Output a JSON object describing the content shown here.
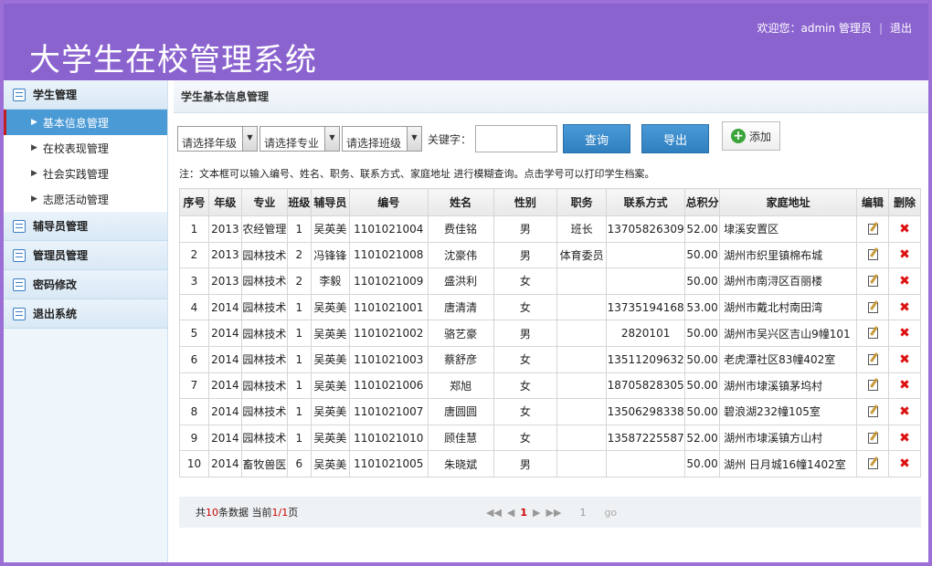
{
  "app": {
    "title": "大学生在校管理系统",
    "welcome": "欢迎您：admin 管理员",
    "logout": "退出"
  },
  "sidebar": {
    "groups": [
      {
        "label": "学生管理"
      },
      {
        "label": "辅导员管理"
      },
      {
        "label": "管理员管理"
      },
      {
        "label": "密码修改"
      },
      {
        "label": "退出系统"
      }
    ],
    "sub_items": [
      {
        "label": "基本信息管理"
      },
      {
        "label": "在校表现管理"
      },
      {
        "label": "社会实践管理"
      },
      {
        "label": "志愿活动管理"
      }
    ]
  },
  "main": {
    "heading": "学生基本信息管理",
    "filters": {
      "year": "请选择年级",
      "major": "请选择专业",
      "class": "请选择班级",
      "keyword_label": "关键字：",
      "keyword_value": ""
    },
    "buttons": {
      "query": "查询",
      "export": "导出",
      "add": "添加"
    },
    "note": "注：文本框可以输入编号、姓名、职务、联系方式、家庭地址 进行模糊查询。点击学号可以打印学生档案。",
    "table": {
      "headers": [
        "序号",
        "年级",
        "专业",
        "班级",
        "辅导员",
        "编号",
        "姓名",
        "性别",
        "职务",
        "联系方式",
        "总积分",
        "家庭地址",
        "编辑",
        "删除"
      ],
      "rows": [
        [
          "1",
          "2013",
          "农经管理",
          "1",
          "吴英美",
          "1101021004",
          "费佳铭",
          "男",
          "班长",
          "13705826309",
          "52.00",
          "埭溪安置区"
        ],
        [
          "2",
          "2013",
          "园林技术",
          "2",
          "冯锋锋",
          "1101021008",
          "沈豪伟",
          "男",
          "体育委员",
          "",
          "50.00",
          "湖州市织里镇棉布城"
        ],
        [
          "3",
          "2013",
          "园林技术",
          "2",
          "李毅",
          "1101021009",
          "盛洪利",
          "女",
          "",
          "",
          "50.00",
          "湖州市南浔区百丽楼"
        ],
        [
          "4",
          "2014",
          "园林技术",
          "1",
          "吴英美",
          "1101021001",
          "唐清清",
          "女",
          "",
          "13735194168",
          "53.00",
          "湖州市戴北村南田湾"
        ],
        [
          "5",
          "2014",
          "园林技术",
          "1",
          "吴英美",
          "1101021002",
          "骆艺豪",
          "男",
          "",
          "2820101",
          "50.00",
          "湖州市吴兴区吉山9幢101"
        ],
        [
          "6",
          "2014",
          "园林技术",
          "1",
          "吴英美",
          "1101021003",
          "蔡舒彦",
          "女",
          "",
          "13511209632",
          "50.00",
          "老虎潭社区83幢402室"
        ],
        [
          "7",
          "2014",
          "园林技术",
          "1",
          "吴英美",
          "1101021006",
          "郑旭",
          "女",
          "",
          "18705828305",
          "50.00",
          "湖州市埭溪镇茅坞村"
        ],
        [
          "8",
          "2014",
          "园林技术",
          "1",
          "吴英美",
          "1101021007",
          "唐圆圆",
          "女",
          "",
          "13506298338",
          "50.00",
          "碧浪湖232幢105室"
        ],
        [
          "9",
          "2014",
          "园林技术",
          "1",
          "吴英美",
          "1101021010",
          "顾佳慧",
          "女",
          "",
          "13587225587",
          "52.00",
          "湖州市埭溪镇方山村"
        ],
        [
          "10",
          "2014",
          "畜牧兽医",
          "6",
          "吴英美",
          "1101021005",
          "朱晓斌",
          "男",
          "",
          "",
          "50.00",
          "湖州 日月城16幢1402室"
        ]
      ]
    },
    "pager": {
      "prefix": "共",
      "total": "10",
      "mid": "条数据 当前",
      "current": "1/1",
      "suffix": "页",
      "page": "1",
      "go_input": "1",
      "go": "go"
    }
  }
}
